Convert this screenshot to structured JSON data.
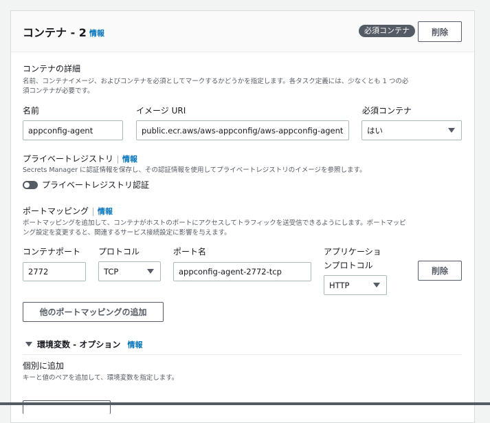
{
  "header": {
    "title": "コンテナ - 2",
    "info": "情報",
    "badge": "必須コンテナ",
    "delete_label": "削除"
  },
  "details": {
    "title": "コンテナの詳細",
    "desc_line1": "名前、コンテナイメージ、およびコンテナを必須としてマークするかどうかを指定します。各タスク定義には、少なくとも 1 つの必",
    "desc_line2": "須コンテナが必要です。",
    "name_label": "名前",
    "name_value": "appconfig-agent",
    "image_label": "イメージ URI",
    "image_value": "public.ecr.aws/aws-appconfig/aws-appconfig-agent",
    "essential_label": "必須コンテナ",
    "essential_value": "はい"
  },
  "private_registry": {
    "title": "プライベートレジストリ",
    "info": "情報",
    "desc": "Secrets Manager に認証情報を保存し、その認証情報を使用してプライベートレジストリのイメージを参照します。",
    "toggle_label": "プライベートレジストリ認証",
    "toggle_on": false
  },
  "port_mapping": {
    "title": "ポートマッピング",
    "info": "情報",
    "desc_line1": "ポートマッピングを追加して、コンテナがホストのポートにアクセスしてトラフィックを送受信できるようにします。ポートマッピ",
    "desc_line2": "ング設定を変更すると、関連するサービス接続設定に影響を与えます。",
    "container_port_label": "コンテナポート",
    "container_port_value": "2772",
    "protocol_label": "プロトコル",
    "protocol_value": "TCP",
    "port_name_label": "ポート名",
    "port_name_value": "appconfig-agent-2772-tcp",
    "app_protocol_label_line1": "アプリケーショ",
    "app_protocol_label_line2": "ンプロトコル",
    "app_protocol_value": "HTTP",
    "delete_label": "削除",
    "add_label": "他のポートマッピングの追加"
  },
  "env_vars": {
    "title": "環境変数 - オプション",
    "info": "情報",
    "individual_title": "個別に追加",
    "individual_desc": "キーと値のペアを追加して、環境変数を指定します。"
  }
}
